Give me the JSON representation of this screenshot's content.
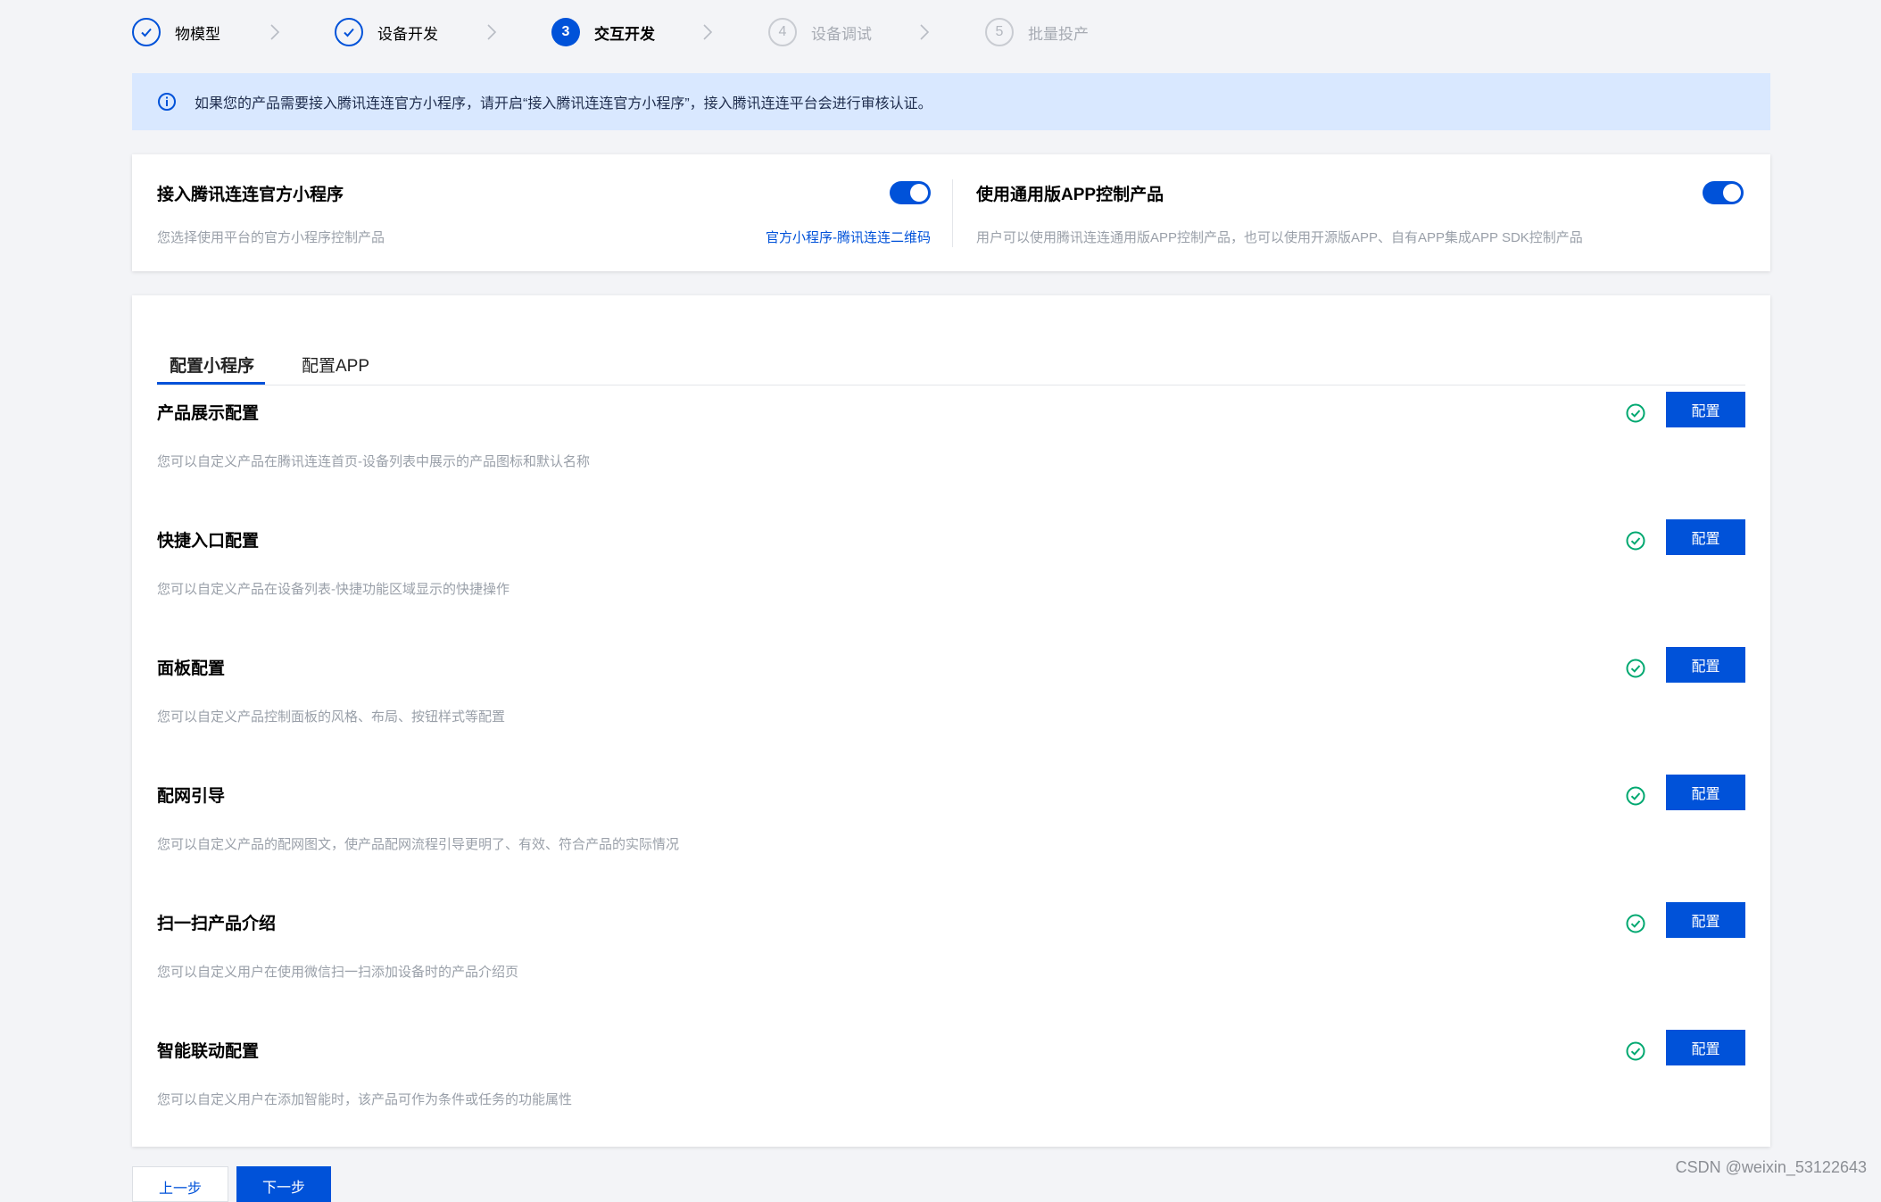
{
  "steps": [
    {
      "number": "1",
      "label": "物模型",
      "state": "done"
    },
    {
      "number": "2",
      "label": "设备开发",
      "state": "done"
    },
    {
      "number": "3",
      "label": "交互开发",
      "state": "current"
    },
    {
      "number": "4",
      "label": "设备调试",
      "state": "pending"
    },
    {
      "number": "5",
      "label": "批量投产",
      "state": "pending"
    }
  ],
  "notice": {
    "text": "如果您的产品需要接入腾讯连连官方小程序，请开启“接入腾讯连连官方小程序”，接入腾讯连连平台会进行审核认证。"
  },
  "toggles": {
    "mini_program": {
      "title": "接入腾讯连连官方小程序",
      "desc": "您选择使用平台的官方小程序控制产品",
      "link": "官方小程序-腾讯连连二维码",
      "enabled": true
    },
    "app": {
      "title": "使用通用版APP控制产品",
      "desc": "用户可以使用腾讯连连通用版APP控制产品，也可以使用开源版APP、自有APP集成APP SDK控制产品",
      "enabled": true
    }
  },
  "tabs": [
    {
      "label": "配置小程序",
      "active": true
    },
    {
      "label": "配置APP",
      "active": false
    }
  ],
  "config_items": [
    {
      "title": "产品展示配置",
      "desc": "您可以自定义产品在腾讯连连首页-设备列表中展示的产品图标和默认名称",
      "button": "配置",
      "status": "configured"
    },
    {
      "title": "快捷入口配置",
      "desc": "您可以自定义产品在设备列表-快捷功能区域显示的快捷操作",
      "button": "配置",
      "status": "configured"
    },
    {
      "title": "面板配置",
      "desc": "您可以自定义产品控制面板的风格、布局、按钮样式等配置",
      "button": "配置",
      "status": "configured"
    },
    {
      "title": "配网引导",
      "desc": "您可以自定义产品的配网图文，使产品配网流程引导更明了、有效、符合产品的实际情况",
      "button": "配置",
      "status": "configured"
    },
    {
      "title": "扫一扫产品介绍",
      "desc": "您可以自定义用户在使用微信扫一扫添加设备时的产品介绍页",
      "button": "配置",
      "status": "configured"
    },
    {
      "title": "智能联动配置",
      "desc": "您可以自定义用户在添加智能时，该产品可作为条件或任务的功能属性",
      "button": "配置",
      "status": "configured"
    }
  ],
  "footer": {
    "prev": "上一步",
    "next": "下一步"
  },
  "watermark": "CSDN @weixin_53122643",
  "colors": {
    "brand": "#0052d9",
    "success": "#00a870",
    "notice_bg": "#d9e8ff",
    "page_bg": "#f3f4f7"
  },
  "icons": {
    "step_done": "check-icon",
    "step_arrow": "chevron-right-icon",
    "notice": "info-circle-icon",
    "config_status": "check-circle-icon"
  }
}
